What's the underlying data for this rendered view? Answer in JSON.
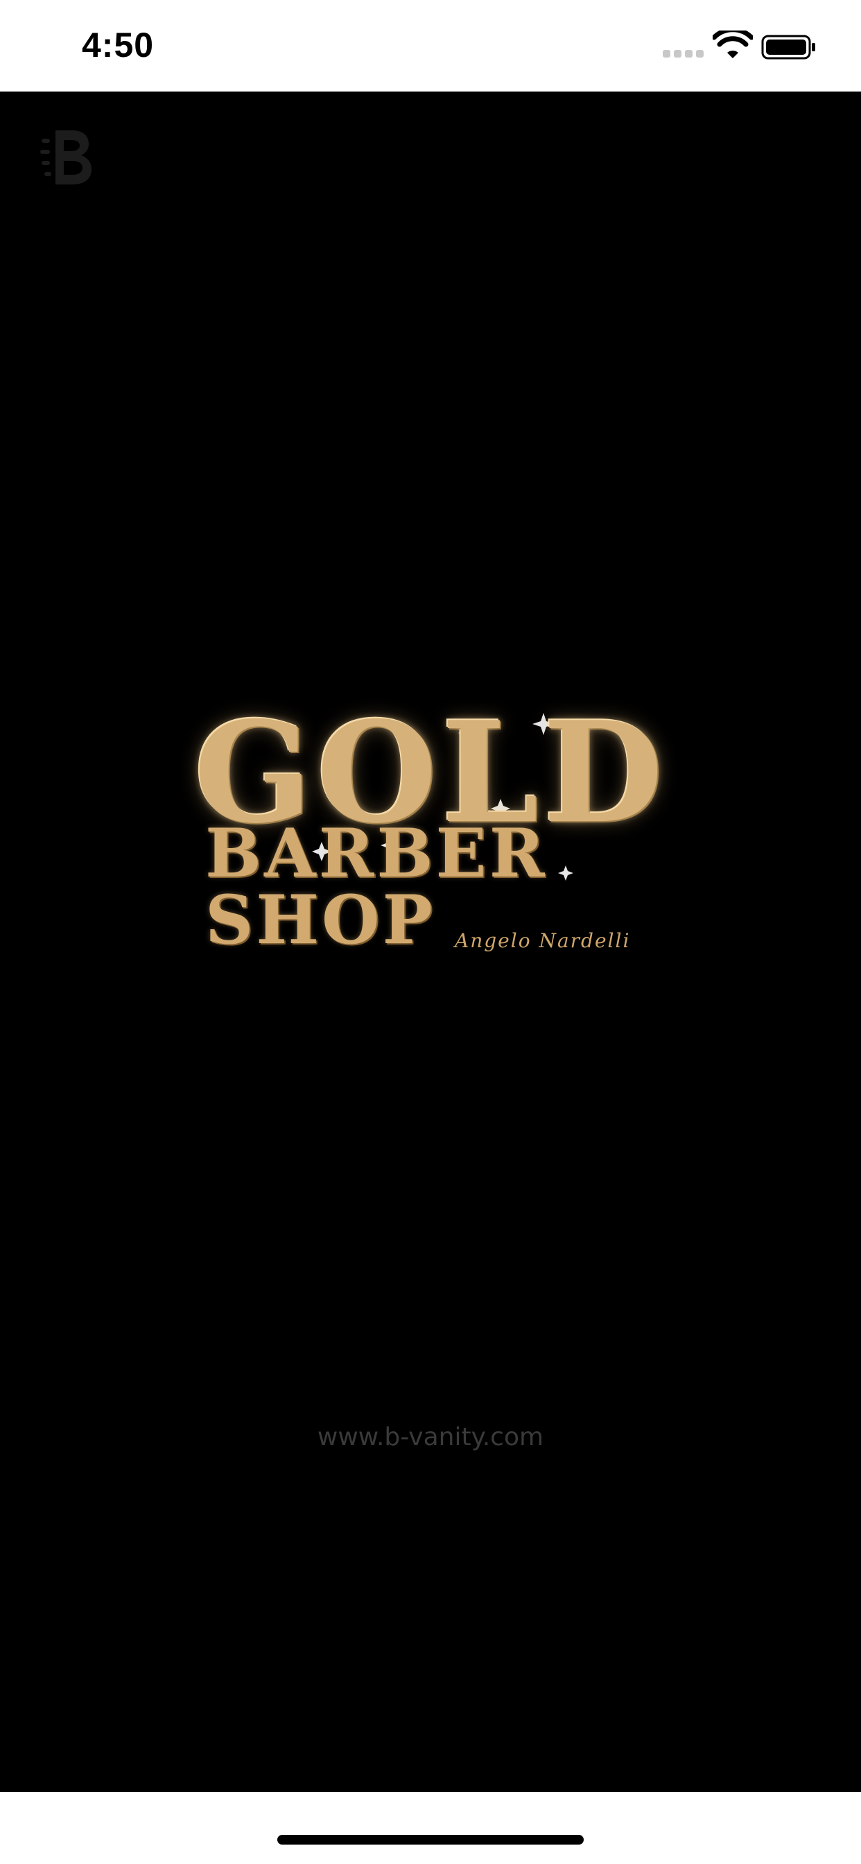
{
  "status_bar": {
    "time": "4:50"
  },
  "splash": {
    "logo": {
      "word": "GOLD",
      "subtitle": "BARBER SHOP",
      "signature": "Angelo Nardelli"
    },
    "website": "www.b-vanity.com"
  },
  "icons": {
    "brand_mark": "b-logo-icon",
    "wifi": "wifi-icon",
    "battery": "battery-icon"
  },
  "colors": {
    "background": "#000000",
    "gold": "#d6b27a",
    "website_text": "#3a3a3a"
  }
}
